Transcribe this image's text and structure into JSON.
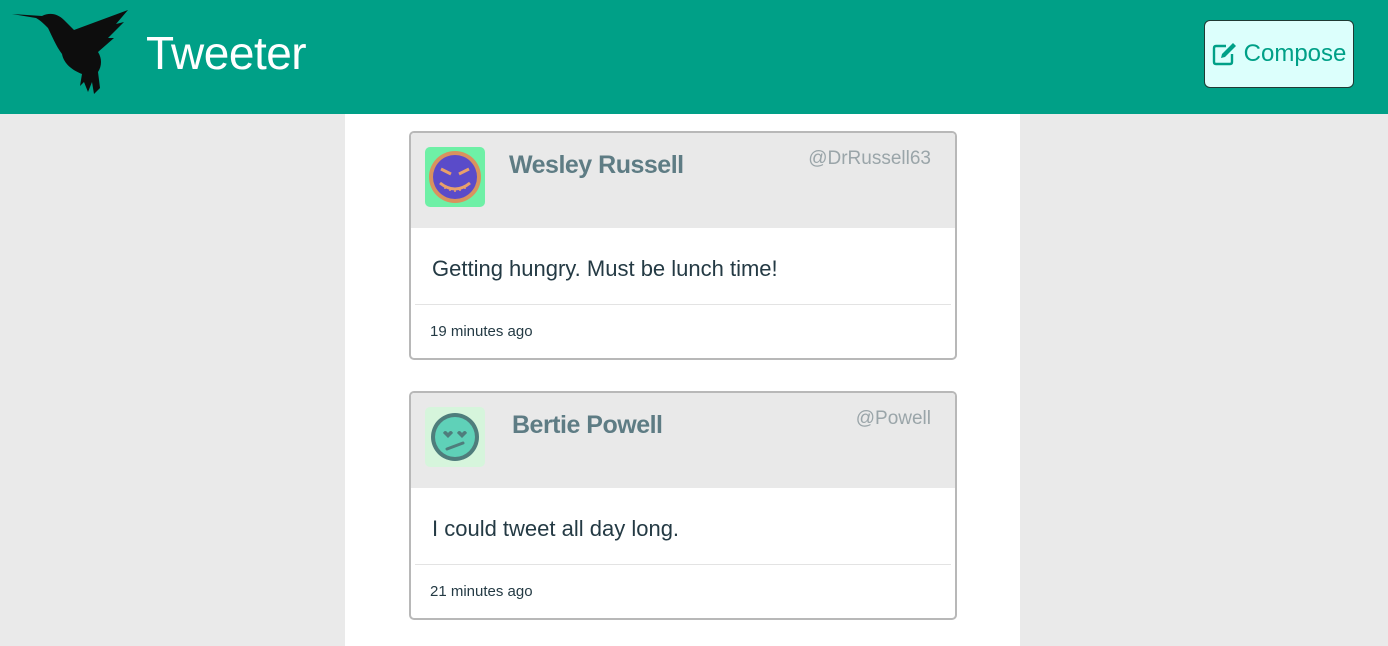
{
  "navbar": {
    "brand": "Tweeter",
    "compose_label": "Compose",
    "background_color": "#00a087"
  },
  "tweets": [
    {
      "name": "Wesley Russell",
      "handle": "@DrRussell63",
      "content": "Getting hungry. Must be lunch time!",
      "time": "19 minutes ago",
      "avatar_icon": "grinning-devil-face-icon",
      "avatar_bg": "#6ef0a6"
    },
    {
      "name": "Bertie Powell",
      "handle": "@Powell",
      "content": "I could tweet all day long.",
      "time": "21 minutes ago",
      "avatar_icon": "heart-eyes-face-icon",
      "avatar_bg": "#d6f5dc"
    }
  ]
}
